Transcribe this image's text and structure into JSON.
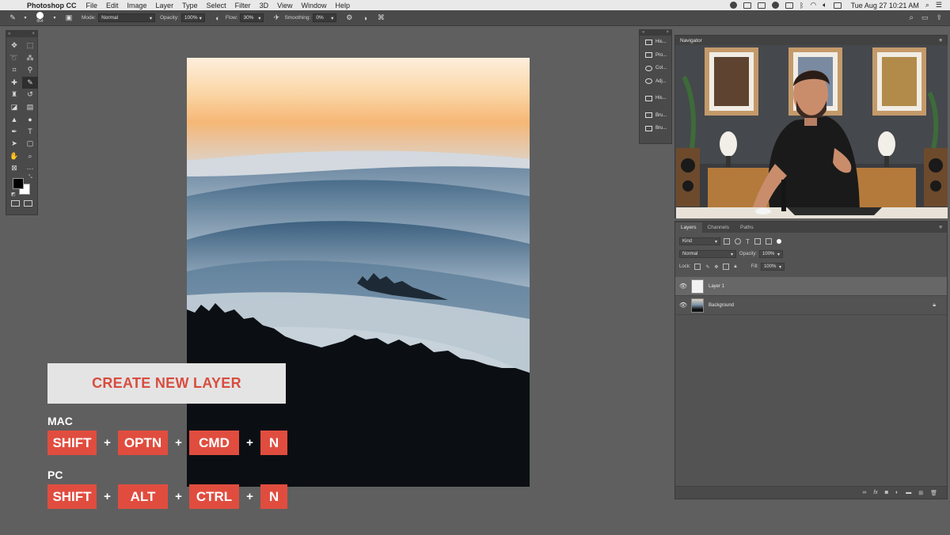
{
  "menubar": {
    "app_name": "Photoshop CC",
    "items": [
      "File",
      "Edit",
      "Image",
      "Layer",
      "Type",
      "Select",
      "Filter",
      "3D",
      "View",
      "Window",
      "Help"
    ],
    "clock": "Tue Aug 27  10:21 AM"
  },
  "options_bar": {
    "brush_size": "864",
    "mode_label": "Mode:",
    "mode_value": "Normal",
    "opacity_label": "Opacity:",
    "opacity_value": "100%",
    "flow_label": "Flow:",
    "flow_value": "30%",
    "smoothing_label": "Smoothing:",
    "smoothing_value": "0%"
  },
  "overlay": {
    "title": "CREATE NEW LAYER",
    "mac_label": "MAC",
    "mac_keys": [
      "SHIFT",
      "OPTN",
      "CMD",
      "N"
    ],
    "pc_label": "PC",
    "pc_keys": [
      "SHIFT",
      "ALT",
      "CTRL",
      "N"
    ],
    "plus": "+"
  },
  "mini_dock": {
    "items": [
      "His...",
      "Pro...",
      "Col...",
      "Adj...",
      "His...",
      "Bru...",
      "Bru..."
    ]
  },
  "navigator": {
    "title": "Navigator"
  },
  "layers_panel": {
    "tabs": [
      "Layers",
      "Channels",
      "Paths"
    ],
    "filter_kind": "Kind",
    "blend_mode": "Normal",
    "opacity_label": "Opacity:",
    "opacity_value": "100%",
    "lock_label": "Lock:",
    "fill_label": "Fill:",
    "fill_value": "100%",
    "layers": [
      {
        "name": "Layer 1",
        "selected": true
      },
      {
        "name": "Background",
        "selected": false,
        "locked": true
      }
    ]
  },
  "colors": {
    "accent_red": "#e04d3f",
    "title_red": "#d84d3f",
    "workspace": "#5f5f5f",
    "panel": "#4a4a4a"
  }
}
